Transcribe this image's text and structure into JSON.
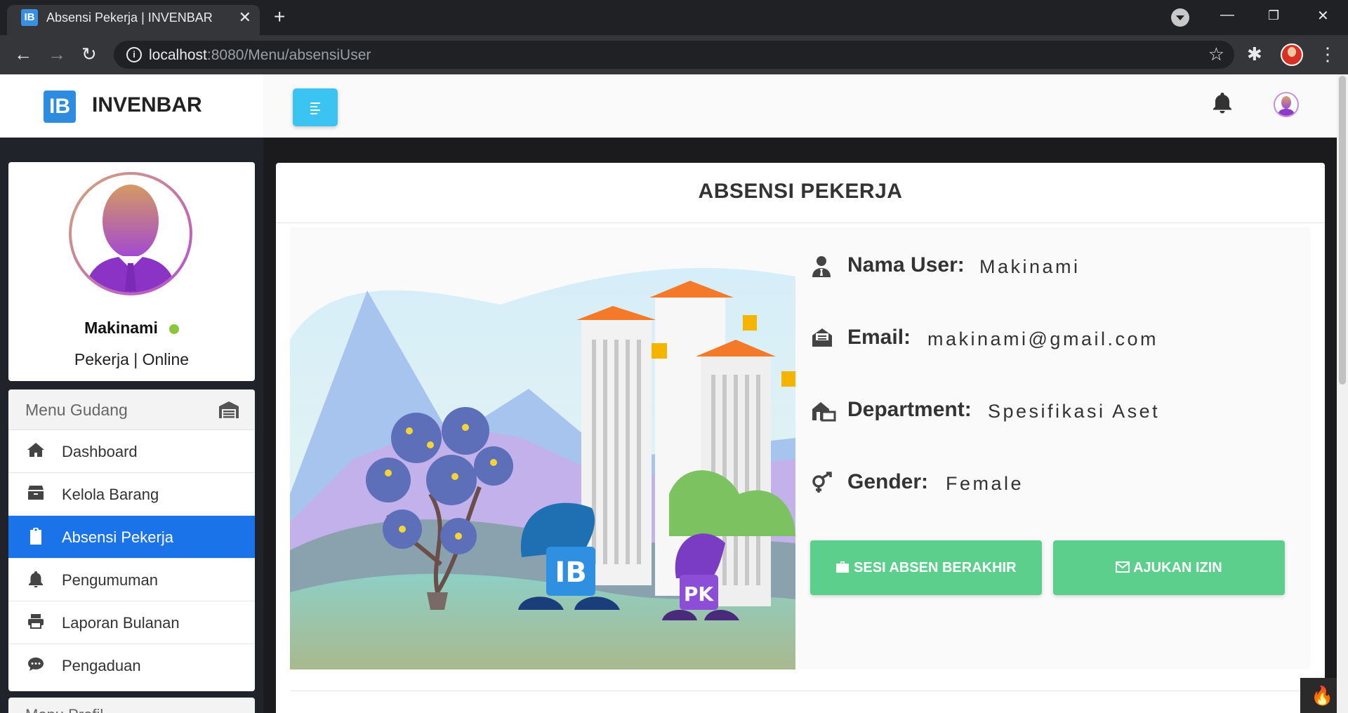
{
  "browser": {
    "tab_favicon": "IB",
    "tab_title": "Absensi Pekerja | INVENBAR",
    "tab_close": "✕",
    "new_tab": "+",
    "url_host": "localhost",
    "url_rest": ":8080/Menu/absensiUser",
    "icons": [
      "back-icon",
      "forward-icon",
      "reload-icon",
      "info-icon",
      "star-icon",
      "extensions-icon",
      "profile-icon",
      "menu-icon"
    ]
  },
  "brand": {
    "logo": "IB",
    "name": "INVENBAR"
  },
  "profile": {
    "name": "Makinami",
    "role": "Pekerja | Online"
  },
  "menu": {
    "header": "Menu Gudang",
    "items": [
      {
        "label": "Dashboard",
        "icon": "home-icon",
        "active": false
      },
      {
        "label": "Kelola Barang",
        "icon": "box-icon",
        "active": false
      },
      {
        "label": "Absensi Pekerja",
        "icon": "clipboard-icon",
        "active": true
      },
      {
        "label": "Pengumuman",
        "icon": "bell-icon",
        "active": false
      },
      {
        "label": "Laporan Bulanan",
        "icon": "printer-icon",
        "active": false
      },
      {
        "label": "Pengaduan",
        "icon": "chat-icon",
        "active": false
      }
    ],
    "next_header": "Menu Profil"
  },
  "page": {
    "title": "ABSENSI PEKERJA",
    "fields": [
      {
        "label": "Nama User:",
        "value": "Makinami",
        "icon": "user-tie-icon"
      },
      {
        "label": "Email:",
        "value": "makinami@gmail.com",
        "icon": "envelope-open-icon"
      },
      {
        "label": "Department:",
        "value": "Spesifikasi Aset",
        "icon": "building-icon"
      },
      {
        "label": "Gender:",
        "value": "Female",
        "icon": "gender-icon"
      }
    ],
    "buttons": {
      "end_session": "SESI ABSEN BERAKHIR",
      "request_leave": "AJUKAN IZIN"
    },
    "illustration_text": {
      "left": "IB",
      "right": "PK"
    }
  },
  "colors": {
    "accent": "#3bc4f1",
    "active_menu": "#1a73e8",
    "button_green": "#5bcf8b",
    "online": "#8cc63f"
  }
}
